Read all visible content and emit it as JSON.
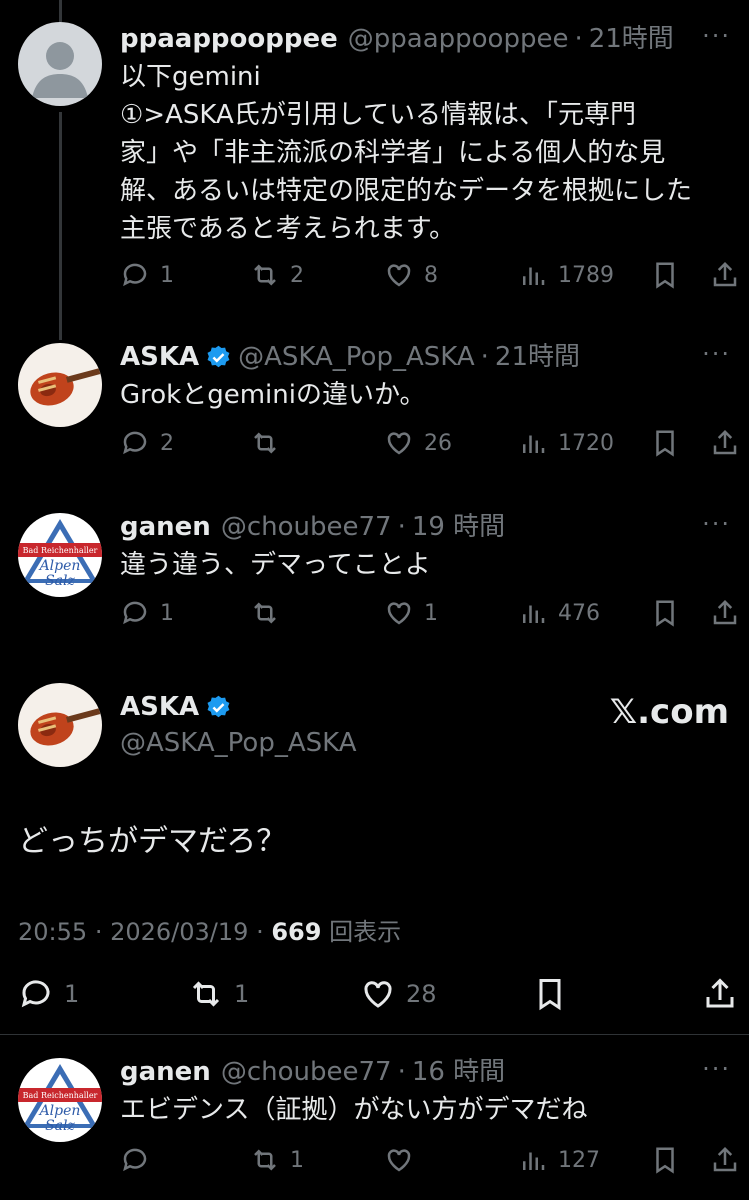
{
  "tweets": [
    {
      "name": "ppaappooppee",
      "handle": "@ppaappooppee",
      "time": "21時間",
      "verified": false,
      "lines": [
        "以下gemini",
        "①>ASKA氏が引用している情報は、「元専門",
        "家」や「非主流派の科学者」による個人的な見",
        "解、あるいは特定の限定的なデータを根拠にした",
        "主張であると考えられます。"
      ],
      "replies": "1",
      "reposts": "2",
      "likes": "8",
      "views": "1789"
    },
    {
      "name": "ASKA",
      "handle": "@ASKA_Pop_ASKA",
      "time": "21時間",
      "verified": true,
      "lines": [
        "Grokとgeminiの違いか。"
      ],
      "replies": "2",
      "reposts": "",
      "likes": "26",
      "views": "1720"
    },
    {
      "name": "ganen",
      "handle": "@choubee77",
      "time": "19 時間",
      "verified": false,
      "lines": [
        "違う違う、デマってことよ"
      ],
      "replies": "1",
      "reposts": "",
      "likes": "1",
      "views": "476"
    }
  ],
  "main": {
    "name": "ASKA",
    "handle": "@ASKA_Pop_ASKA",
    "source": "𝕏.com",
    "text": "どっちがデマだろ？",
    "time": "20:55",
    "date": "2026/03/19",
    "views_count": "669",
    "views_label": "回表示",
    "replies": "1",
    "reposts": "1",
    "likes": "28"
  },
  "reply": {
    "name": "ganen",
    "handle": "@choubee77",
    "time": "16 時間",
    "text": "エビデンス（証拠）がない方がデマだね",
    "replies": "",
    "reposts": "1",
    "likes": "",
    "views": "127"
  },
  "avatar_text": {
    "line1": "Bad Reichenhaller",
    "line2": "Alpen",
    "line3": "Salz"
  },
  "separator_dot": "·",
  "more": "···",
  "colors": {
    "background": "#000000",
    "text": "#e7e9ea",
    "muted": "#71767b",
    "verified": "#1d9bf0"
  }
}
